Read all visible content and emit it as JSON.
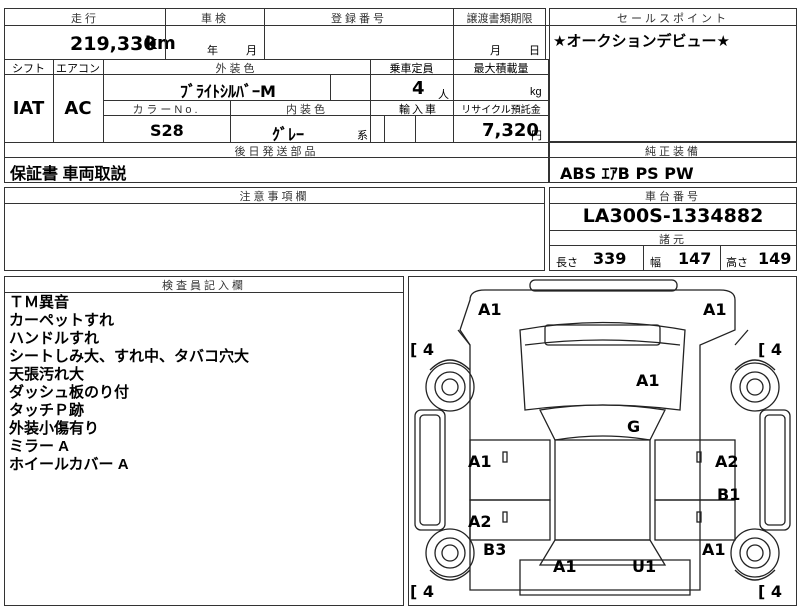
{
  "top": {
    "mileage_label": "走行",
    "mileage_value": "219,330",
    "mileage_unit": "km",
    "inspection_label": "車検",
    "inspection_year": "年",
    "inspection_month": "月",
    "registration_label": "登録番号",
    "transfer_label": "譲渡書類期限",
    "transfer_month": "月",
    "transfer_day": "日"
  },
  "selling": {
    "label": "セールスポイント",
    "text": "★オークションデビュー★"
  },
  "specs": {
    "shift_label": "シフト",
    "shift_value": "IAT",
    "ac_label": "エアコン",
    "ac_value": "AC",
    "exterior_label": "外装色",
    "exterior_value": "ﾌﾞﾗｲﾄｼﾙﾊﾞｰM",
    "capacity_label": "乗車定員",
    "capacity_value": "4",
    "capacity_unit": "人",
    "maxload_label": "最大積載量",
    "maxload_unit": "kg",
    "color_no_label": "カラーNo.",
    "color_no_value": "S28",
    "interior_label": "内装色",
    "interior_value": "ｸﾞﾚｰ",
    "interior_suffix": "系",
    "import_label": "輸入車",
    "recycle_label": "リサイクル預託金",
    "recycle_value": "7,320",
    "recycle_unit": "円"
  },
  "later": {
    "label": "後日発送部品",
    "value": "保証書 車両取説"
  },
  "genuine": {
    "label": "純正装備",
    "value": "ABS ｴｱB PS PW"
  },
  "notes": {
    "label": "注意事項欄"
  },
  "chassis": {
    "label": "車台番号",
    "value": "LA300S-1334882",
    "dims_label": "諸元",
    "length_label": "長さ",
    "length_value": "339",
    "width_label": "幅",
    "width_value": "147",
    "height_label": "高さ",
    "height_value": "149"
  },
  "inspector": {
    "label": "検査員記入欄",
    "lines": [
      "ＴＭ異音",
      "カーペットすれ",
      "ハンドルすれ",
      "シートしみ大、すれ中、タバコ穴大",
      "天張汚れ大",
      "ダッシュ板のり付",
      "タッチＰ跡",
      "外装小傷有り",
      "ミラー A",
      "ホイールカバー A"
    ]
  },
  "diagram": {
    "marks": {
      "front_left": "A1",
      "front_right": "A1",
      "hood": "A1",
      "windshield": "G",
      "left_fender": "A1",
      "right_fender": "A2",
      "right_front_door": "B1",
      "left_door": "A2",
      "left_rear": "B3",
      "right_rear": "A1",
      "rear_left": "A1",
      "rear_center": "U1"
    },
    "tire_labels": [
      "[ 4",
      "[ 4",
      "[ 4",
      "[ 4"
    ]
  }
}
